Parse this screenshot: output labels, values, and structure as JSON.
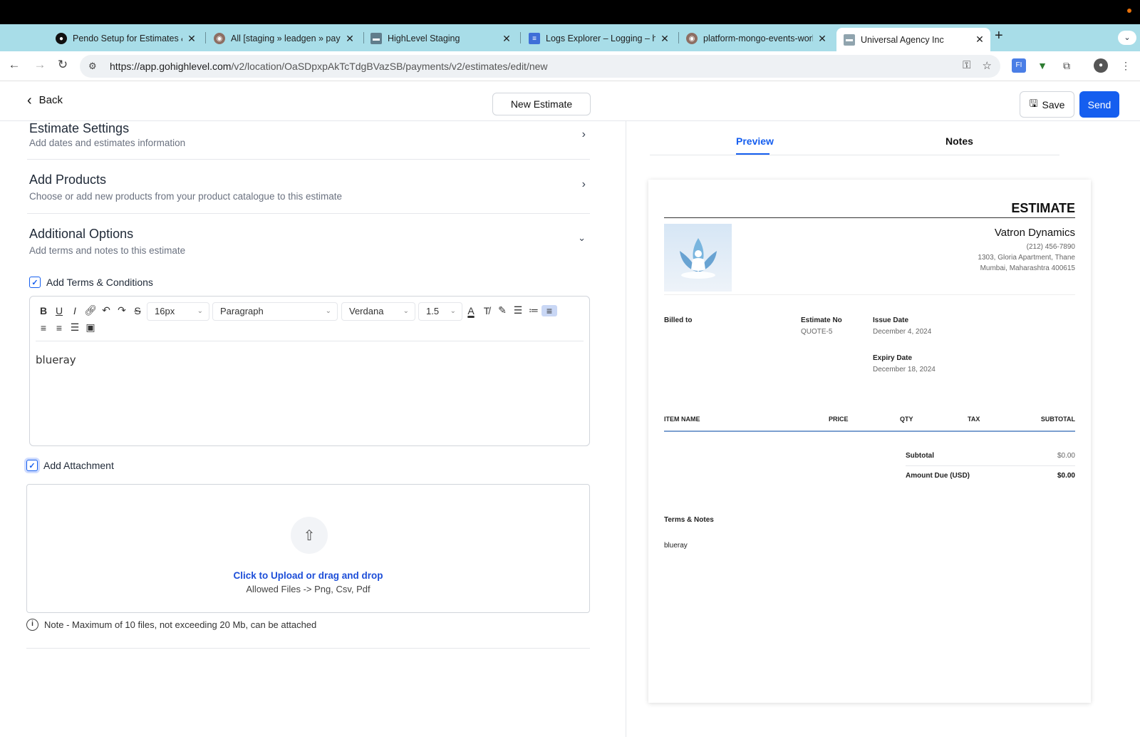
{
  "browser": {
    "tabs": [
      {
        "title": "Pendo Setup for Estimates &"
      },
      {
        "title": "All [staging » leadgen » paym"
      },
      {
        "title": "HighLevel Staging"
      },
      {
        "title": "Logs Explorer – Logging – hig"
      },
      {
        "title": "platform-mongo-events-work"
      },
      {
        "title": "Universal Agency Inc",
        "active": true
      }
    ],
    "url_host": "https://app.gohighlevel.com",
    "url_path": "/v2/location/OaSDpxpAkTcTdgBVazSB/payments/v2/estimates/edit/new"
  },
  "header": {
    "back_label": "Back",
    "estimate_title": "New Estimate",
    "save_label": "Save",
    "send_label": "Send"
  },
  "sections": {
    "settings": {
      "title": "Estimate Settings",
      "subtitle": "Add dates and estimates information"
    },
    "products": {
      "title": "Add Products",
      "subtitle": "Choose or add new products from your product catalogue to this estimate"
    },
    "options": {
      "title": "Additional Options",
      "subtitle": "Add terms and notes to this estimate"
    }
  },
  "terms": {
    "checkbox_label": "Add Terms & Conditions",
    "font_size": "16px",
    "block_type": "Paragraph",
    "font_family": "Verdana",
    "line_height": "1.5",
    "content": "blueray"
  },
  "attachment": {
    "checkbox_label": "Add Attachment",
    "upload_link": "Click to Upload or drag and drop",
    "allowed": "Allowed Files -> Png, Csv, Pdf",
    "note": "Note - Maximum of 10 files, not exceeding 20 Mb, can be attached"
  },
  "right_tabs": {
    "preview": "Preview",
    "notes": "Notes"
  },
  "preview": {
    "doc_title": "ESTIMATE",
    "company_name": "Vatron Dynamics",
    "company_phone": "(212) 456-7890",
    "company_address1": "1303, Gloria Apartment, Thane",
    "company_address2": "Mumbai, Maharashtra 400615",
    "billed_to_label": "Billed to",
    "estimate_no_label": "Estimate No",
    "estimate_no": "QUOTE-5",
    "issue_date_label": "Issue Date",
    "issue_date": "December 4, 2024",
    "expiry_date_label": "Expiry Date",
    "expiry_date": "December 18, 2024",
    "columns": [
      "ITEM NAME",
      "PRICE",
      "QTY",
      "TAX",
      "SUBTOTAL"
    ],
    "subtotal_label": "Subtotal",
    "subtotal_value": "$0.00",
    "amount_due_label": "Amount Due (USD)",
    "amount_due_value": "$0.00",
    "terms_label": "Terms & Notes",
    "terms_content": "blueray"
  },
  "colors": {
    "accent": "#155eef",
    "tabstrip": "#a8dde8"
  }
}
